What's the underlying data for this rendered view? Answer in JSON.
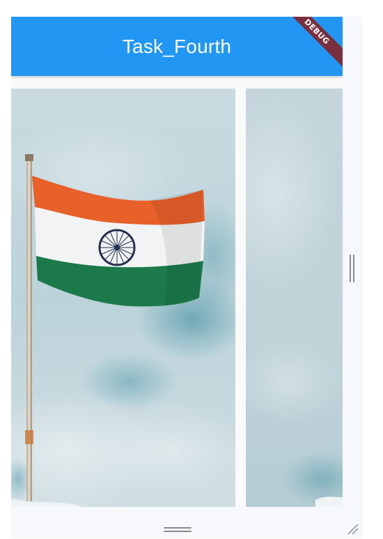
{
  "app_bar": {
    "title": "Task_Fourth",
    "color": "#2196f3"
  },
  "debug_banner": {
    "label": "DEBUG",
    "color": "#7a2f3e"
  },
  "carousel": {
    "items": [
      {
        "icon": "indian-flag-on-pole-image"
      },
      {
        "icon": "cloudy-sky-image"
      }
    ]
  }
}
